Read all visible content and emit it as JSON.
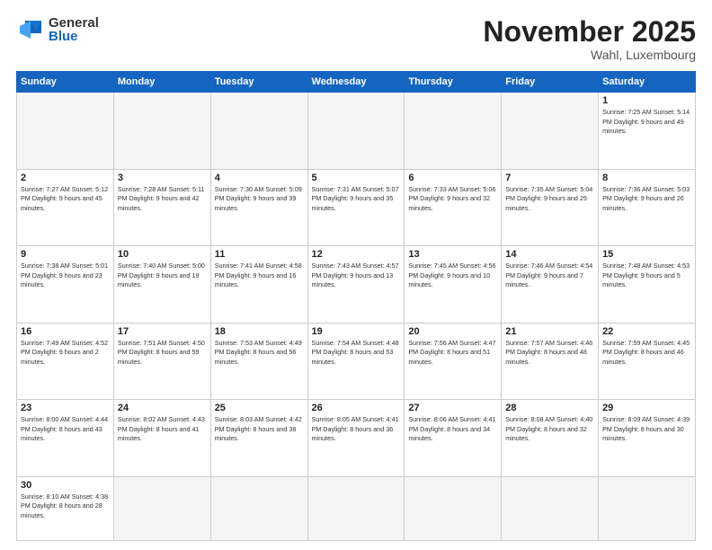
{
  "logo": {
    "general": "General",
    "blue": "Blue"
  },
  "title": "November 2025",
  "subtitle": "Wahl, Luxembourg",
  "days_of_week": [
    "Sunday",
    "Monday",
    "Tuesday",
    "Wednesday",
    "Thursday",
    "Friday",
    "Saturday"
  ],
  "weeks": [
    [
      {
        "day": "",
        "info": "",
        "empty": true
      },
      {
        "day": "",
        "info": "",
        "empty": true
      },
      {
        "day": "",
        "info": "",
        "empty": true
      },
      {
        "day": "",
        "info": "",
        "empty": true
      },
      {
        "day": "",
        "info": "",
        "empty": true
      },
      {
        "day": "",
        "info": "",
        "empty": true
      },
      {
        "day": "1",
        "info": "Sunrise: 7:25 AM\nSunset: 5:14 PM\nDaylight: 9 hours\nand 49 minutes."
      }
    ],
    [
      {
        "day": "2",
        "info": "Sunrise: 7:27 AM\nSunset: 5:12 PM\nDaylight: 9 hours\nand 45 minutes."
      },
      {
        "day": "3",
        "info": "Sunrise: 7:28 AM\nSunset: 5:11 PM\nDaylight: 9 hours\nand 42 minutes."
      },
      {
        "day": "4",
        "info": "Sunrise: 7:30 AM\nSunset: 5:09 PM\nDaylight: 9 hours\nand 39 minutes."
      },
      {
        "day": "5",
        "info": "Sunrise: 7:31 AM\nSunset: 5:07 PM\nDaylight: 9 hours\nand 35 minutes."
      },
      {
        "day": "6",
        "info": "Sunrise: 7:33 AM\nSunset: 5:06 PM\nDaylight: 9 hours\nand 32 minutes."
      },
      {
        "day": "7",
        "info": "Sunrise: 7:35 AM\nSunset: 5:04 PM\nDaylight: 9 hours\nand 29 minutes."
      },
      {
        "day": "8",
        "info": "Sunrise: 7:36 AM\nSunset: 5:03 PM\nDaylight: 9 hours\nand 26 minutes."
      }
    ],
    [
      {
        "day": "9",
        "info": "Sunrise: 7:38 AM\nSunset: 5:01 PM\nDaylight: 9 hours\nand 23 minutes."
      },
      {
        "day": "10",
        "info": "Sunrise: 7:40 AM\nSunset: 5:00 PM\nDaylight: 9 hours\nand 19 minutes."
      },
      {
        "day": "11",
        "info": "Sunrise: 7:41 AM\nSunset: 4:58 PM\nDaylight: 9 hours\nand 16 minutes."
      },
      {
        "day": "12",
        "info": "Sunrise: 7:43 AM\nSunset: 4:57 PM\nDaylight: 9 hours\nand 13 minutes."
      },
      {
        "day": "13",
        "info": "Sunrise: 7:45 AM\nSunset: 4:56 PM\nDaylight: 9 hours\nand 10 minutes."
      },
      {
        "day": "14",
        "info": "Sunrise: 7:46 AM\nSunset: 4:54 PM\nDaylight: 9 hours\nand 7 minutes."
      },
      {
        "day": "15",
        "info": "Sunrise: 7:48 AM\nSunset: 4:53 PM\nDaylight: 9 hours\nand 5 minutes."
      }
    ],
    [
      {
        "day": "16",
        "info": "Sunrise: 7:49 AM\nSunset: 4:52 PM\nDaylight: 9 hours\nand 2 minutes."
      },
      {
        "day": "17",
        "info": "Sunrise: 7:51 AM\nSunset: 4:50 PM\nDaylight: 8 hours\nand 59 minutes."
      },
      {
        "day": "18",
        "info": "Sunrise: 7:53 AM\nSunset: 4:49 PM\nDaylight: 8 hours\nand 56 minutes."
      },
      {
        "day": "19",
        "info": "Sunrise: 7:54 AM\nSunset: 4:48 PM\nDaylight: 8 hours\nand 53 minutes."
      },
      {
        "day": "20",
        "info": "Sunrise: 7:56 AM\nSunset: 4:47 PM\nDaylight: 8 hours\nand 51 minutes."
      },
      {
        "day": "21",
        "info": "Sunrise: 7:57 AM\nSunset: 4:46 PM\nDaylight: 8 hours\nand 48 minutes."
      },
      {
        "day": "22",
        "info": "Sunrise: 7:59 AM\nSunset: 4:45 PM\nDaylight: 8 hours\nand 46 minutes."
      }
    ],
    [
      {
        "day": "23",
        "info": "Sunrise: 8:00 AM\nSunset: 4:44 PM\nDaylight: 8 hours\nand 43 minutes."
      },
      {
        "day": "24",
        "info": "Sunrise: 8:02 AM\nSunset: 4:43 PM\nDaylight: 8 hours\nand 41 minutes."
      },
      {
        "day": "25",
        "info": "Sunrise: 8:03 AM\nSunset: 4:42 PM\nDaylight: 8 hours\nand 38 minutes."
      },
      {
        "day": "26",
        "info": "Sunrise: 8:05 AM\nSunset: 4:41 PM\nDaylight: 8 hours\nand 36 minutes."
      },
      {
        "day": "27",
        "info": "Sunrise: 8:06 AM\nSunset: 4:41 PM\nDaylight: 8 hours\nand 34 minutes."
      },
      {
        "day": "28",
        "info": "Sunrise: 8:08 AM\nSunset: 4:40 PM\nDaylight: 8 hours\nand 32 minutes."
      },
      {
        "day": "29",
        "info": "Sunrise: 8:09 AM\nSunset: 4:39 PM\nDaylight: 8 hours\nand 30 minutes."
      }
    ],
    [
      {
        "day": "30",
        "info": "Sunrise: 8:10 AM\nSunset: 4:38 PM\nDaylight: 8 hours\nand 28 minutes."
      },
      {
        "day": "",
        "info": "",
        "empty": true
      },
      {
        "day": "",
        "info": "",
        "empty": true
      },
      {
        "day": "",
        "info": "",
        "empty": true
      },
      {
        "day": "",
        "info": "",
        "empty": true
      },
      {
        "day": "",
        "info": "",
        "empty": true
      },
      {
        "day": "",
        "info": "",
        "empty": true
      }
    ]
  ]
}
